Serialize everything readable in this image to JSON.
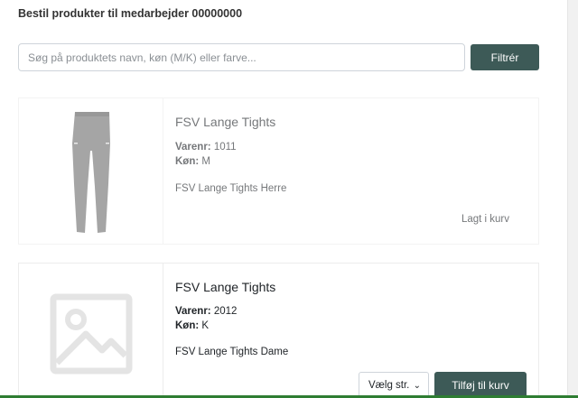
{
  "page": {
    "title": "Bestil produkter til medarbejder 00000000"
  },
  "search": {
    "placeholder": "Søg på produktets navn, køn (M/K) eller farve...",
    "value": "",
    "button_label": "Filtrér"
  },
  "products": [
    {
      "name": "FSV Lange Tights",
      "varenr_label": "Varenr:",
      "varenr": "1011",
      "gender_label": "Køn:",
      "gender": "M",
      "description": "FSV Lange Tights Herre",
      "status": "Lagt i kurv",
      "image": "tights-product-image"
    },
    {
      "name": "FSV Lange Tights",
      "varenr_label": "Varenr:",
      "varenr": "2012",
      "gender_label": "Køn:",
      "gender": "K",
      "description": "FSV Lange Tights Dame",
      "image": "image-placeholder-icon",
      "size_select": {
        "selected": "Vælg str."
      },
      "add_button_label": "Tilføj til kurv"
    }
  ],
  "colors": {
    "button_bg": "#3d5a57",
    "accent_line": "#2e7d32"
  }
}
